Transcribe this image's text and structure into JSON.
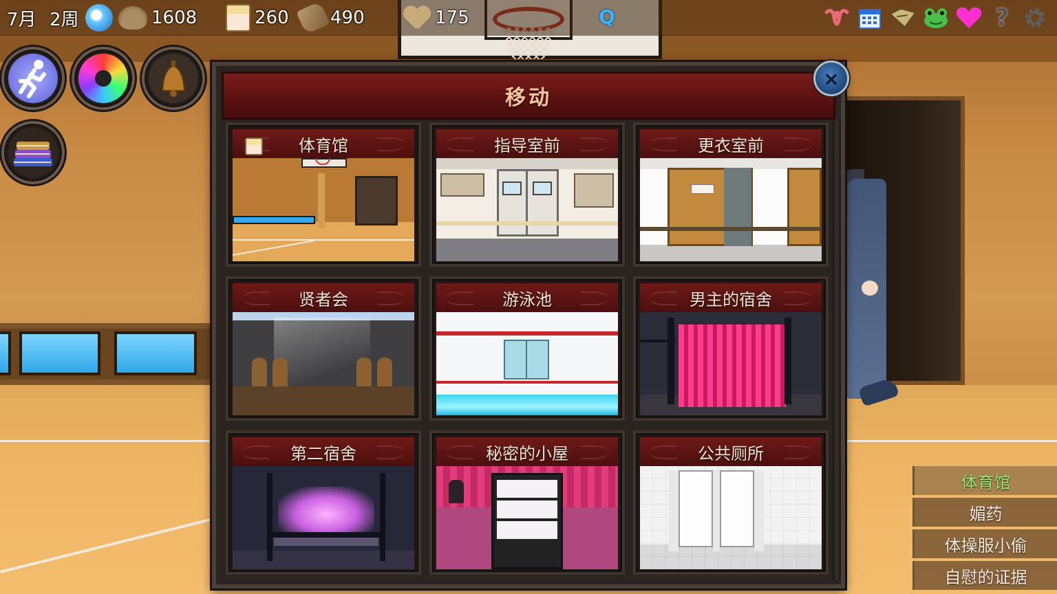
{
  "hud": {
    "month": "7月",
    "week": "2周",
    "money": "1608",
    "affection": "260",
    "scrolls": "490",
    "hearts": "175",
    "quest_marker": "Q",
    "right_icons": [
      "uterus-icon",
      "calendar-icon",
      "map-icon",
      "frog-icon",
      "heart-icon",
      "help-icon",
      "gear-icon"
    ],
    "help_glyph": "?"
  },
  "left_buttons": [
    "run-icon",
    "camera-icon",
    "bell-icon",
    "books-icon"
  ],
  "move_panel": {
    "title": "移动",
    "close_glyph": "×",
    "locations": [
      {
        "label": "体育馆",
        "scene": "gym",
        "current": true
      },
      {
        "label": "指导室前",
        "scene": "office"
      },
      {
        "label": "更衣室前",
        "scene": "locker"
      },
      {
        "label": "贤者会",
        "scene": "council"
      },
      {
        "label": "游泳池",
        "scene": "pool"
      },
      {
        "label": "男主的宿舍",
        "scene": "dorm1"
      },
      {
        "label": "第二宿舍",
        "scene": "dorm2"
      },
      {
        "label": "秘密的小屋",
        "scene": "shop"
      },
      {
        "label": "公共厕所",
        "scene": "toilet"
      }
    ]
  },
  "side_actions": [
    {
      "label": "体育馆",
      "active": true
    },
    {
      "label": "媚药"
    },
    {
      "label": "体操服小偷"
    },
    {
      "label": "自慰的证据"
    }
  ],
  "colors": {
    "panel_header": "#6e1a18",
    "card_label": "#f2e3d3",
    "active_action": "#8ee97a",
    "title": "#f3c59a"
  }
}
